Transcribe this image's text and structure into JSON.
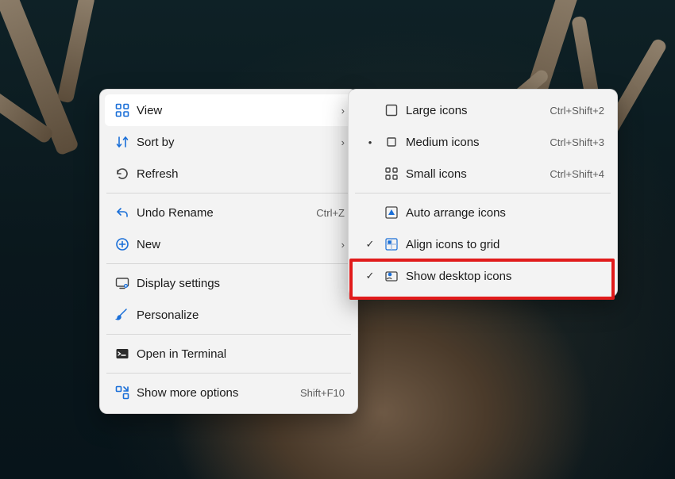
{
  "primary_menu": {
    "view": {
      "label": "View"
    },
    "sort_by": {
      "label": "Sort by"
    },
    "refresh": {
      "label": "Refresh"
    },
    "undo_rename": {
      "label": "Undo Rename",
      "shortcut": "Ctrl+Z"
    },
    "new": {
      "label": "New"
    },
    "display": {
      "label": "Display settings"
    },
    "personalize": {
      "label": "Personalize"
    },
    "terminal": {
      "label": "Open in Terminal"
    },
    "more": {
      "label": "Show more options",
      "shortcut": "Shift+F10"
    }
  },
  "view_submenu": {
    "large": {
      "label": "Large icons",
      "shortcut": "Ctrl+Shift+2"
    },
    "medium": {
      "label": "Medium icons",
      "shortcut": "Ctrl+Shift+3",
      "selected_glyph": "•"
    },
    "small": {
      "label": "Small icons",
      "shortcut": "Ctrl+Shift+4"
    },
    "auto": {
      "label": "Auto arrange icons"
    },
    "align": {
      "label": "Align icons to grid",
      "checked_glyph": "✓"
    },
    "show": {
      "label": "Show desktop icons",
      "checked_glyph": "✓"
    }
  }
}
